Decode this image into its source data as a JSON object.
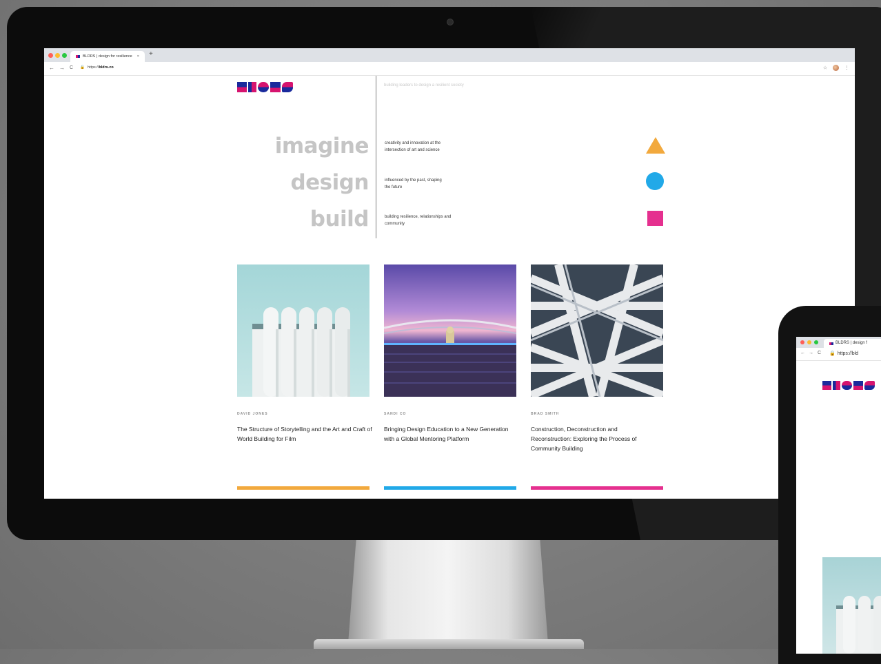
{
  "browser": {
    "tab_title": "BLDRS | design for resilience",
    "tab_close": "×",
    "new_tab": "+",
    "url_scheme": "https://",
    "url_host": "bldrs.co",
    "nav_back": "←",
    "nav_forward": "→",
    "nav_reload": "C",
    "lock": "🔒",
    "bookmark_star": "☆",
    "menu": "⋮"
  },
  "site": {
    "logo_text": "BLDRS",
    "tagline": "building leaders to design a resilient society",
    "pillars": [
      {
        "word": "imagine",
        "description": "creativity and innovation at the intersection of art and science",
        "shape": "triangle",
        "color": "#f2a93d"
      },
      {
        "word": "design",
        "description": "influenced by the past, shaping the future",
        "shape": "circle",
        "color": "#21a9e8"
      },
      {
        "word": "build",
        "description": "building resilience, relationships and community",
        "shape": "square",
        "color": "#e5308f"
      }
    ],
    "articles": [
      {
        "author": "DAVID JONES",
        "title": "The Structure of Storytelling and the Art and Craft of World Building for Film",
        "accent": "#f2a93d"
      },
      {
        "author": "SANDI CO",
        "title": "Bringing Design Education to a New Generation with a Global Mentoring Platform",
        "accent": "#21a9e8"
      },
      {
        "author": "BRAD SMITH",
        "title": "Construction, Deconstruction and Reconstruction: Exploring the Process of Community Building",
        "accent": "#e5308f"
      }
    ]
  },
  "laptop": {
    "tab_title": "BLDRS | design f",
    "url_scheme": "https://",
    "url_host": "bld",
    "nav_back": "←",
    "nav_forward": "→",
    "nav_reload": "C",
    "lock": "🔒"
  },
  "device": {
    "apple_logo": ""
  }
}
